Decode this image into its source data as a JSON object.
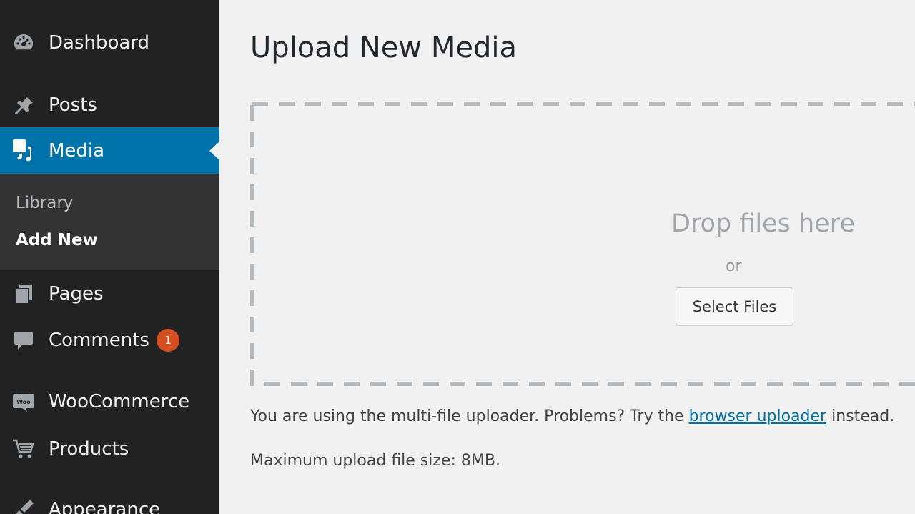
{
  "sidebar": {
    "items": [
      {
        "label": "Dashboard",
        "icon": "dashboard-icon"
      },
      {
        "label": "Posts",
        "icon": "pin-icon"
      },
      {
        "label": "Media",
        "icon": "media-icon",
        "current": true
      },
      {
        "label": "Pages",
        "icon": "pages-icon"
      },
      {
        "label": "Comments",
        "icon": "comment-icon",
        "badge": "1"
      },
      {
        "label": "WooCommerce",
        "icon": "woocommerce-icon"
      },
      {
        "label": "Products",
        "icon": "cart-icon"
      },
      {
        "label": "Appearance",
        "icon": "brush-icon"
      }
    ],
    "submenu": [
      {
        "label": "Library"
      },
      {
        "label": "Add New",
        "current": true
      }
    ]
  },
  "main": {
    "title": "Upload New Media",
    "drop_title": "Drop files here",
    "drop_or": "or",
    "select_button": "Select Files",
    "notice_prefix": "You are using the multi-file uploader. Problems? Try the ",
    "notice_link": "browser uploader",
    "notice_suffix": " instead.",
    "max_size": "Maximum upload file size: 8MB."
  },
  "colors": {
    "sidebar_bg": "#222222",
    "submenu_bg": "#333333",
    "accent": "#0073aa",
    "badge": "#d54e21",
    "content_bg": "#f1f1f1"
  }
}
